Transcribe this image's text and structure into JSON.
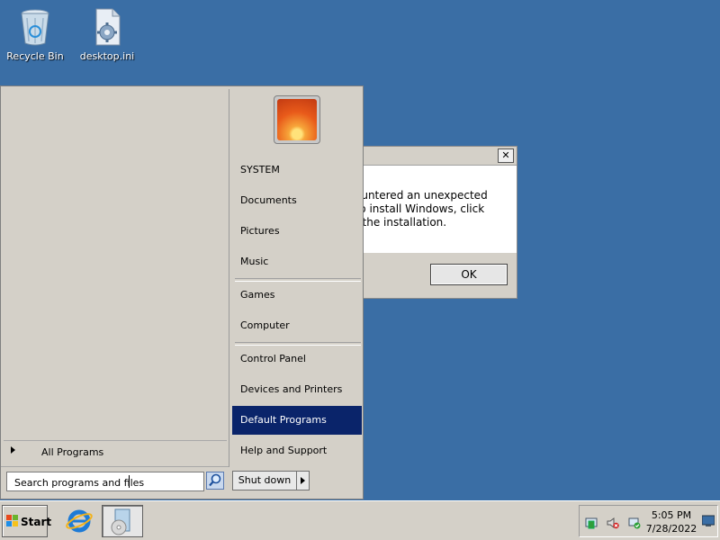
{
  "desktop": {
    "icons": [
      {
        "label": "Recycle Bin",
        "icon": "recycle-bin-icon"
      },
      {
        "label": "desktop.ini",
        "icon": "settings-file-icon"
      }
    ]
  },
  "dialog": {
    "close_symbol": "✕",
    "message_lines": [
      "ountered an unexpected",
      "To install Windows, click",
      "t the installation."
    ],
    "ok_label": "OK"
  },
  "start_menu": {
    "all_programs_label": "All Programs",
    "search": {
      "placeholder": "Search programs and files",
      "value": ""
    },
    "right_items": [
      {
        "label": "SYSTEM"
      },
      {
        "label": "Documents"
      },
      {
        "label": "Pictures"
      },
      {
        "label": "Music"
      },
      {
        "label": "Games"
      },
      {
        "label": "Computer"
      },
      {
        "label": "Control Panel"
      },
      {
        "label": "Devices and Printers"
      },
      {
        "label": "Default Programs",
        "selected": true
      },
      {
        "label": "Help and Support"
      }
    ],
    "shutdown_label": "Shut down"
  },
  "taskbar": {
    "start_label": "Start",
    "pinned": [
      {
        "icon": "internet-explorer-icon"
      },
      {
        "icon": "setup-disc-icon",
        "active": true
      }
    ],
    "tray": {
      "icons": [
        "action-center-icon",
        "volume-muted-icon",
        "network-icon"
      ],
      "time": "5:05 PM",
      "date": "7/28/2022",
      "show_desktop_icon": "show-desktop-icon"
    }
  },
  "colors": {
    "desktop_bg": "#3a6ea5",
    "menu_bg": "#d4d0c8",
    "selection": "#0a246a"
  }
}
